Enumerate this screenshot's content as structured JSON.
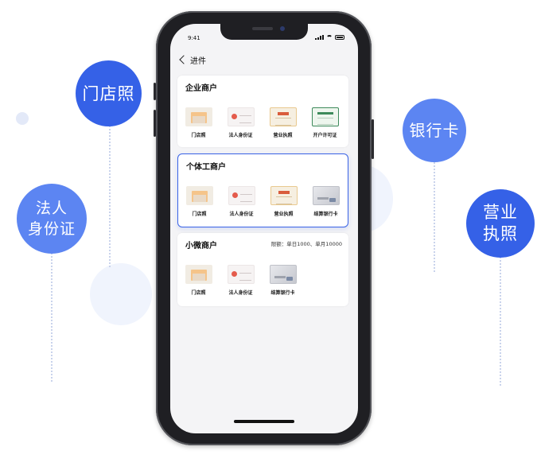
{
  "bubbles": {
    "mendian": "门店照",
    "faren": "法人\n身份证",
    "bank": "银行卡",
    "yingye": "营业\n执照"
  },
  "status_bar": {
    "time": "9:41"
  },
  "nav": {
    "title": "进件"
  },
  "cards": [
    {
      "title": "企业商户",
      "note": "",
      "docs": [
        {
          "label": "门店照",
          "icon": "storefront-photo-icon"
        },
        {
          "label": "法人身份证",
          "icon": "id-card-icon"
        },
        {
          "label": "营业执照",
          "icon": "business-license-icon"
        },
        {
          "label": "开户许可证",
          "icon": "account-permit-icon"
        }
      ]
    },
    {
      "title": "个体工商户",
      "note": "",
      "docs": [
        {
          "label": "门店照",
          "icon": "storefront-photo-icon"
        },
        {
          "label": "法人身份证",
          "icon": "id-card-icon"
        },
        {
          "label": "营业执照",
          "icon": "business-license-icon"
        },
        {
          "label": "结算银行卡",
          "icon": "bank-card-icon"
        }
      ]
    },
    {
      "title": "小微商户",
      "note": "限额：单日1000、单月10000",
      "docs": [
        {
          "label": "门店照",
          "icon": "storefront-photo-icon"
        },
        {
          "label": "法人身份证",
          "icon": "id-card-icon"
        },
        {
          "label": "结算银行卡",
          "icon": "bank-card-icon"
        }
      ]
    }
  ],
  "colors": {
    "accent": "#3561e7",
    "accent_light": "#5c85f2",
    "selected_border": "#3a63e6",
    "screen_bg": "#f4f4f6"
  }
}
